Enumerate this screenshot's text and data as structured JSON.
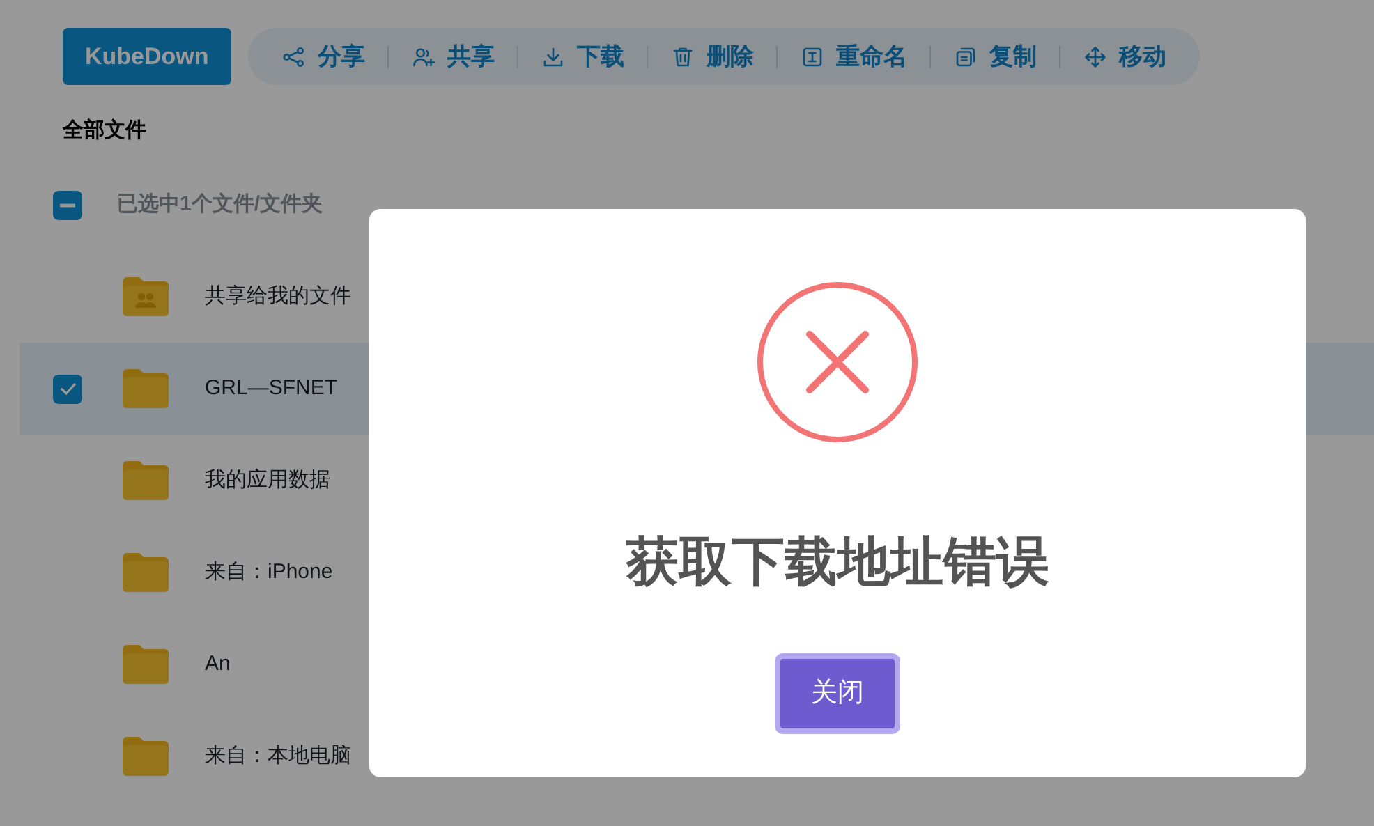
{
  "app_button": "KubeDown",
  "toolbar": [
    {
      "kind": "share",
      "label": "分享"
    },
    {
      "kind": "user-plus",
      "label": "共享"
    },
    {
      "kind": "download",
      "label": "下载"
    },
    {
      "kind": "trash",
      "label": "删除"
    },
    {
      "kind": "rename",
      "label": "重命名"
    },
    {
      "kind": "copy",
      "label": "复制"
    },
    {
      "kind": "move",
      "label": "移动"
    }
  ],
  "breadcrumb": "全部文件",
  "table": {
    "select_all": {
      "indeterminate": true
    },
    "selection_label": "已选中1个文件/文件夹",
    "rows": [
      {
        "kind": "shared-folder",
        "name": "共享给我的文件",
        "selected": false
      },
      {
        "kind": "folder",
        "name": "GRL—SFNET",
        "selected": true
      },
      {
        "kind": "folder",
        "name": "我的应用数据",
        "selected": false
      },
      {
        "kind": "folder",
        "name": "来自：iPhone",
        "selected": false
      },
      {
        "kind": "folder",
        "name": "An",
        "selected": false
      },
      {
        "kind": "folder",
        "name": "来自：本地电脑",
        "selected": false
      }
    ]
  },
  "dialog": {
    "kind": "error",
    "title": "获取下载地址错误",
    "button": "关闭"
  }
}
